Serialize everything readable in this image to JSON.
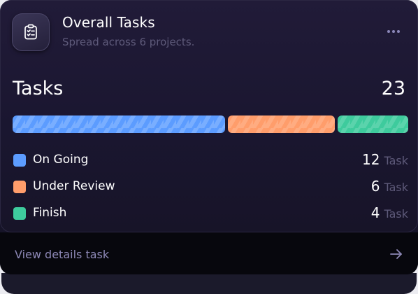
{
  "header": {
    "title": "Overall Tasks",
    "subtitle": "Spread across 6 projects.",
    "app_icon": "clipboard-checklist-icon",
    "more_icon": "more-horizontal-icon"
  },
  "summary": {
    "label": "Tasks",
    "total": "23"
  },
  "progress": {
    "segments": [
      {
        "name": "On Going",
        "value": 12,
        "color": "#5c9cff"
      },
      {
        "name": "Under Review",
        "value": 6,
        "color": "#ff9d6b"
      },
      {
        "name": "Finish",
        "value": 4,
        "color": "#3ecb9d"
      }
    ]
  },
  "legend": [
    {
      "label": "On Going",
      "count": "12",
      "unit": "Task",
      "color": "#5c9cff"
    },
    {
      "label": "Under Review",
      "count": "6",
      "unit": "Task",
      "color": "#ff9d6b"
    },
    {
      "label": "Finish",
      "count": "4",
      "unit": "Task",
      "color": "#3ecb9d"
    }
  ],
  "footer": {
    "label": "View details task",
    "icon": "arrow-right-icon"
  }
}
